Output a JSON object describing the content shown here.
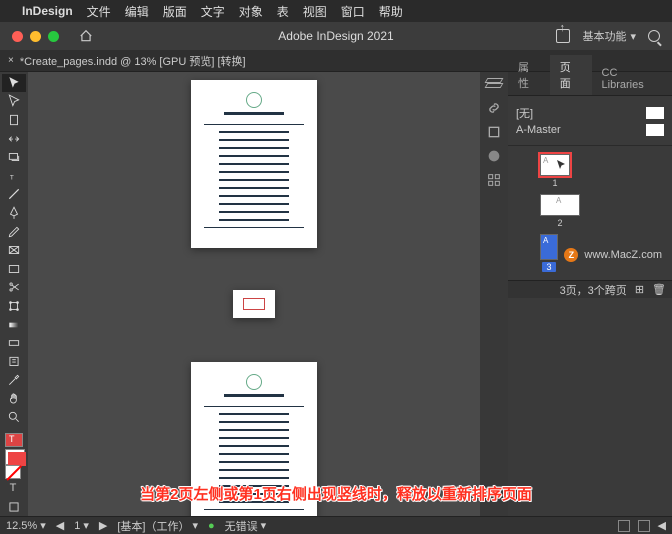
{
  "menubar": {
    "app": "InDesign",
    "items": [
      "文件",
      "编辑",
      "版面",
      "文字",
      "对象",
      "表",
      "视图",
      "窗口",
      "帮助"
    ]
  },
  "window": {
    "title": "Adobe InDesign 2021",
    "workspace": "基本功能"
  },
  "tab": {
    "label": "*Create_pages.indd @ 13% [GPU 预览] [转换]"
  },
  "rpanel": {
    "tabs": [
      "属性",
      "页面",
      "CC Libraries"
    ],
    "masters": {
      "none": "[无]",
      "a": "A-Master"
    },
    "pages": [
      {
        "num": "1",
        "letter": "A"
      },
      {
        "num": "2",
        "letter": "A"
      },
      {
        "num": "3",
        "letter": "A"
      }
    ]
  },
  "watermark": "www.MacZ.com",
  "caption": "当第2页左侧或第1页右侧出现竖线时，释放以重新排序页面",
  "status": {
    "zoom": "12.5%",
    "page": "1",
    "layer": "[基本]（工作）",
    "errors": "无错误"
  },
  "pgstatus": "3页，3个跨页"
}
